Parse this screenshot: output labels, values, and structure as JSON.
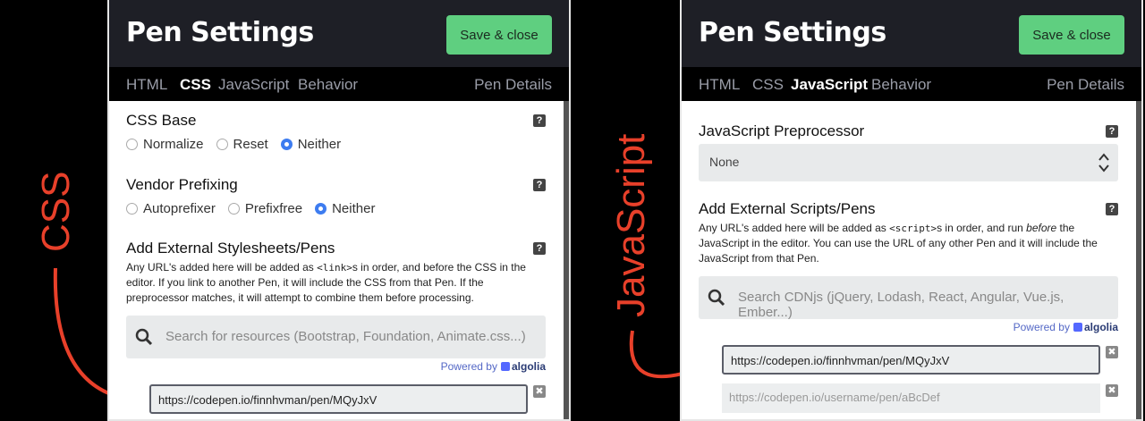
{
  "annotations": {
    "css": "CSS",
    "js": "JavaScript",
    "arrow_color": "#e8402a"
  },
  "panels": {
    "css": {
      "title": "Pen Settings",
      "save_label": "Save & close",
      "tabs": [
        "HTML",
        "CSS",
        "JavaScript",
        "Behavior"
      ],
      "active_tab": "CSS",
      "details_label": "Pen Details",
      "css_base": {
        "title": "CSS Base",
        "options": [
          "Normalize",
          "Reset",
          "Neither"
        ],
        "selected": "Neither"
      },
      "vendor": {
        "title": "Vendor Prefixing",
        "options": [
          "Autoprefixer",
          "Prefixfree",
          "Neither"
        ],
        "selected": "Neither"
      },
      "external": {
        "title": "Add External Stylesheets/Pens",
        "desc_1": "Any URL's added here will be added as ",
        "desc_code": "<link>",
        "desc_2": "s in order, and before the CSS in the editor. If you link to another Pen, it will include the CSS from that Pen. If the preprocessor matches, it will attempt to combine them before processing.",
        "search_placeholder": "Search for resources (Bootstrap, Foundation, Animate.css...)",
        "powered_by": "Powered by",
        "algolia": "algolia",
        "url_value": "https://codepen.io/finnhvman/pen/MQyJxV"
      }
    },
    "js": {
      "title": "Pen Settings",
      "save_label": "Save & close",
      "tabs": [
        "HTML",
        "CSS",
        "JavaScript",
        "Behavior"
      ],
      "active_tab": "JavaScript",
      "details_label": "Pen Details",
      "preprocessor": {
        "title": "JavaScript Preprocessor",
        "value": "None"
      },
      "external": {
        "title": "Add External Scripts/Pens",
        "desc_1": "Any URL's added here will be added as ",
        "desc_code": "<script>",
        "desc_2": "s in order, and run ",
        "desc_em": "before",
        "desc_3": " the JavaScript in the editor. You can use the URL of any other Pen and it will include the JavaScript from that Pen.",
        "search_placeholder": "Search CDNjs (jQuery, Lodash, React, Angular, Vue.js, Ember...)",
        "powered_by": "Powered by",
        "algolia": "algolia",
        "url_value": "https://codepen.io/finnhvman/pen/MQyJxV",
        "url_placeholder": "https://codepen.io/username/pen/aBcDef"
      }
    }
  },
  "colors": {
    "header_bg": "#1e1f26",
    "save_green": "#5fcf80",
    "radio_blue": "#3d7cf0"
  }
}
